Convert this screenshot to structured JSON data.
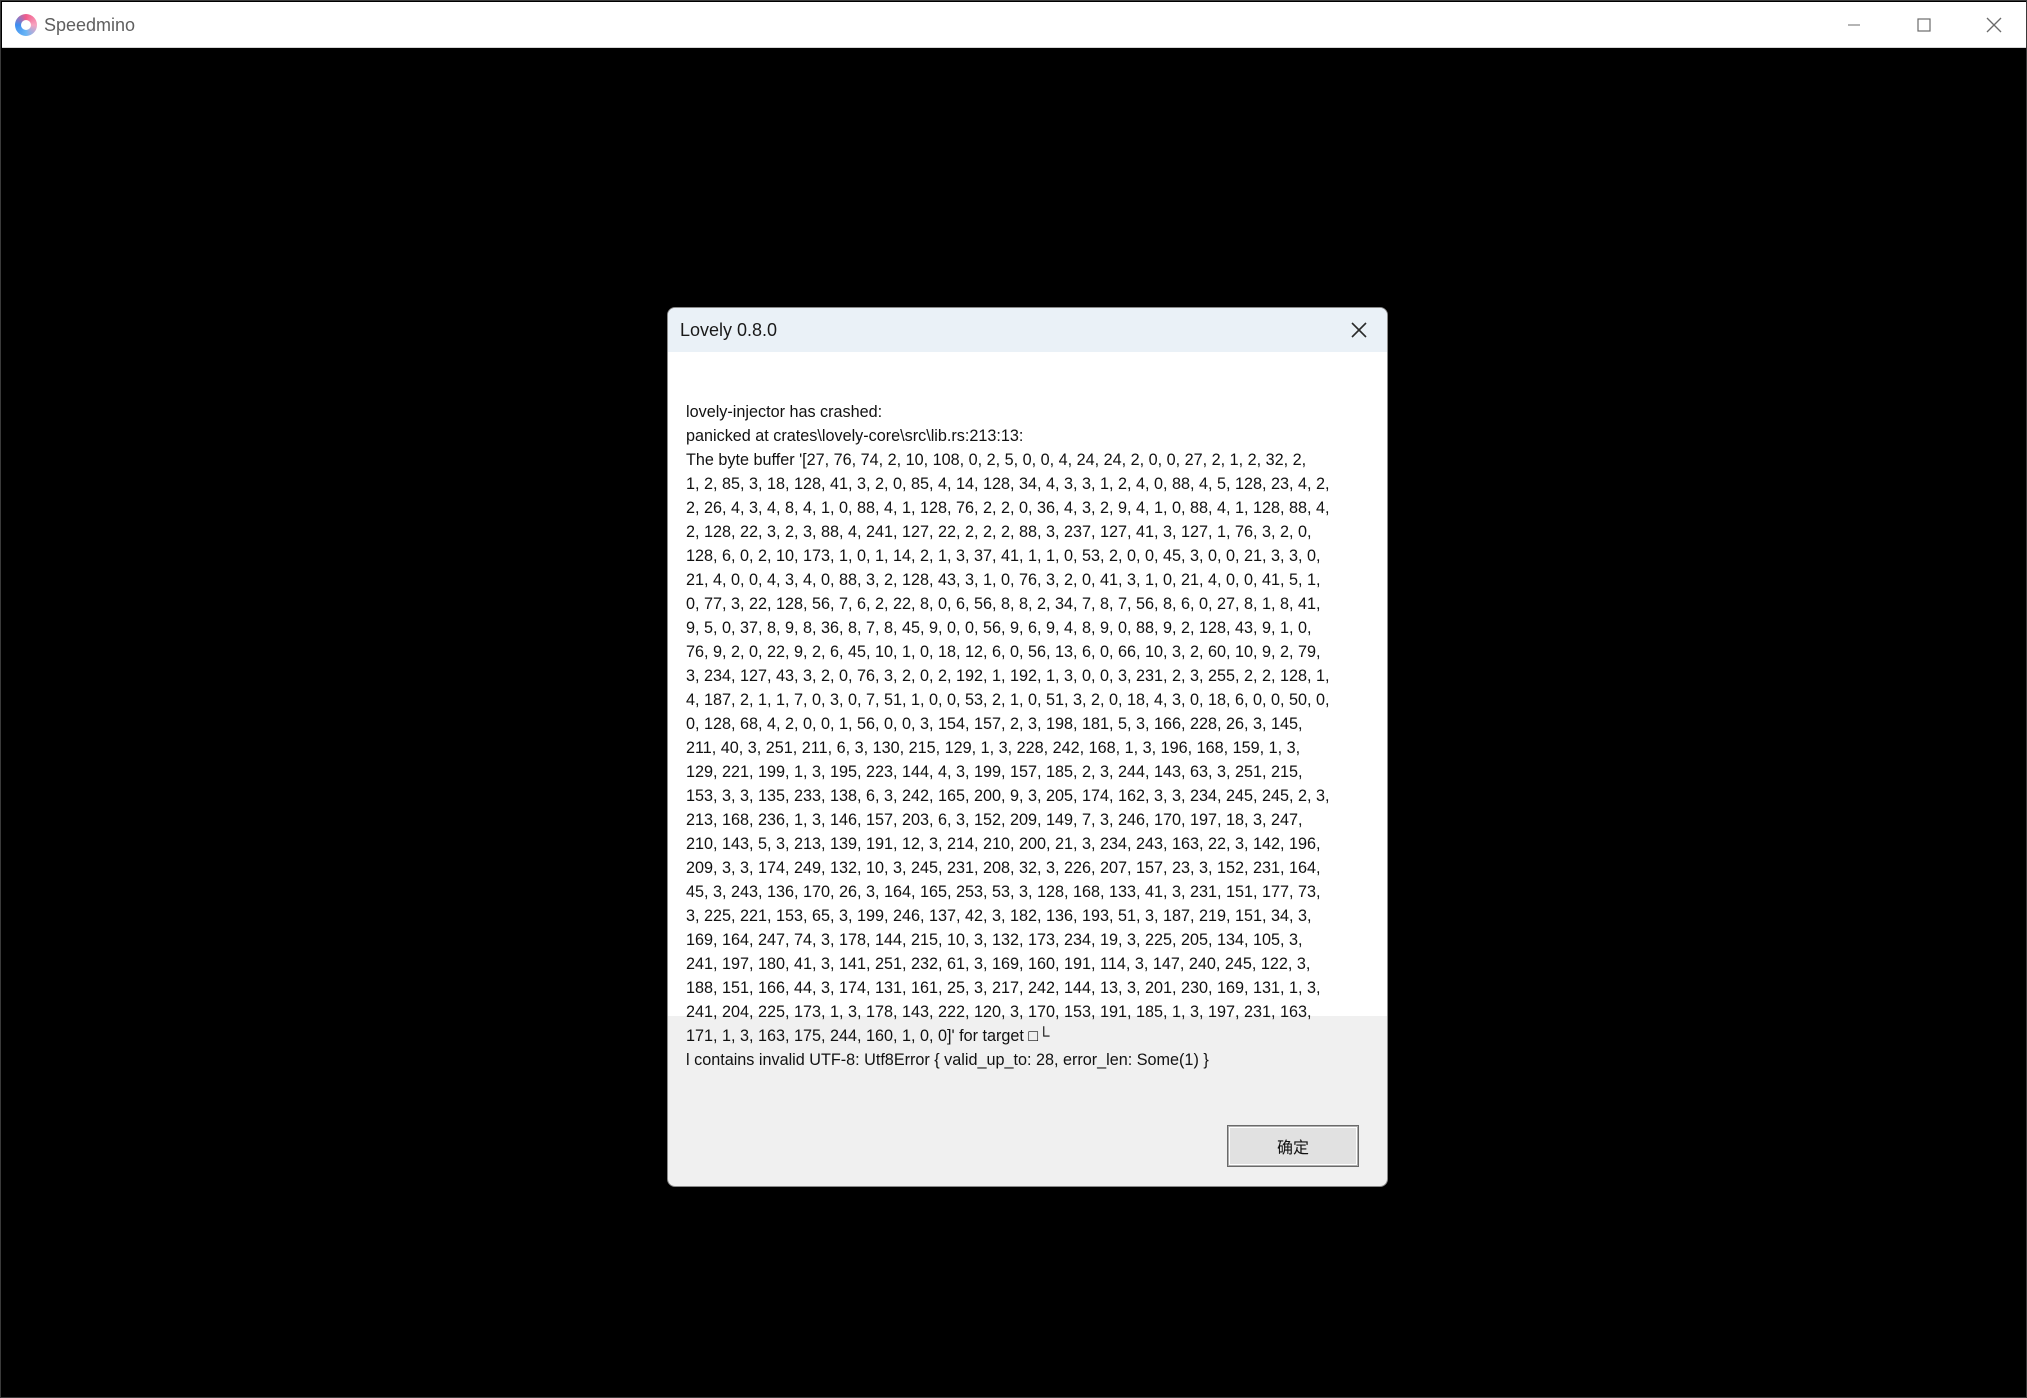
{
  "window": {
    "title": "Speedmino",
    "icon": "speedmino-app-icon",
    "controls": {
      "minimize_icon": "minimize-icon",
      "maximize_icon": "maximize-icon",
      "close_icon": "close-icon"
    }
  },
  "dialog": {
    "title": "Lovely 0.8.0",
    "close_icon": "close-icon",
    "message": "lovely-injector has crashed:\npanicked at crates\\lovely-core\\src\\lib.rs:213:13:\nThe byte buffer '[27, 76, 74, 2, 10, 108, 0, 2, 5, 0, 0, 4, 24, 24, 2, 0, 0, 27, 2, 1, 2, 32, 2,\n1, 2, 85, 3, 18, 128, 41, 3, 2, 0, 85, 4, 14, 128, 34, 4, 3, 3, 1, 2, 4, 0, 88, 4, 5, 128, 23, 4, 2,\n2, 26, 4, 3, 4, 8, 4, 1, 0, 88, 4, 1, 128, 76, 2, 2, 0, 36, 4, 3, 2, 9, 4, 1, 0, 88, 4, 1, 128, 88, 4,\n2, 128, 22, 3, 2, 3, 88, 4, 241, 127, 22, 2, 2, 2, 88, 3, 237, 127, 41, 3, 127, 1, 76, 3, 2, 0,\n128, 6, 0, 2, 10, 173, 1, 0, 1, 14, 2, 1, 3, 37, 41, 1, 1, 0, 53, 2, 0, 0, 45, 3, 0, 0, 21, 3, 3, 0,\n21, 4, 0, 0, 4, 3, 4, 0, 88, 3, 2, 128, 43, 3, 1, 0, 76, 3, 2, 0, 41, 3, 1, 0, 21, 4, 0, 0, 41, 5, 1,\n0, 77, 3, 22, 128, 56, 7, 6, 2, 22, 8, 0, 6, 56, 8, 8, 2, 34, 7, 8, 7, 56, 8, 6, 0, 27, 8, 1, 8, 41,\n9, 5, 0, 37, 8, 9, 8, 36, 8, 7, 8, 45, 9, 0, 0, 56, 9, 6, 9, 4, 8, 9, 0, 88, 9, 2, 128, 43, 9, 1, 0,\n76, 9, 2, 0, 22, 9, 2, 6, 45, 10, 1, 0, 18, 12, 6, 0, 56, 13, 6, 0, 66, 10, 3, 2, 60, 10, 9, 2, 79,\n3, 234, 127, 43, 3, 2, 0, 76, 3, 2, 0, 2, 192, 1, 192, 1, 3, 0, 0, 3, 231, 2, 3, 255, 2, 2, 128, 1,\n4, 187, 2, 1, 1, 7, 0, 3, 0, 7, 51, 1, 0, 0, 53, 2, 1, 0, 51, 3, 2, 0, 18, 4, 3, 0, 18, 6, 0, 0, 50, 0,\n0, 128, 68, 4, 2, 0, 0, 1, 56, 0, 0, 3, 154, 157, 2, 3, 198, 181, 5, 3, 166, 228, 26, 3, 145,\n211, 40, 3, 251, 211, 6, 3, 130, 215, 129, 1, 3, 228, 242, 168, 1, 3, 196, 168, 159, 1, 3,\n129, 221, 199, 1, 3, 195, 223, 144, 4, 3, 199, 157, 185, 2, 3, 244, 143, 63, 3, 251, 215,\n153, 3, 3, 135, 233, 138, 6, 3, 242, 165, 200, 9, 3, 205, 174, 162, 3, 3, 234, 245, 245, 2, 3,\n213, 168, 236, 1, 3, 146, 157, 203, 6, 3, 152, 209, 149, 7, 3, 246, 170, 197, 18, 3, 247,\n210, 143, 5, 3, 213, 139, 191, 12, 3, 214, 210, 200, 21, 3, 234, 243, 163, 22, 3, 142, 196,\n209, 3, 3, 174, 249, 132, 10, 3, 245, 231, 208, 32, 3, 226, 207, 157, 23, 3, 152, 231, 164,\n45, 3, 243, 136, 170, 26, 3, 164, 165, 253, 53, 3, 128, 168, 133, 41, 3, 231, 151, 177, 73,\n3, 225, 221, 153, 65, 3, 199, 246, 137, 42, 3, 182, 136, 193, 51, 3, 187, 219, 151, 34, 3,\n169, 164, 247, 74, 3, 178, 144, 215, 10, 3, 132, 173, 234, 19, 3, 225, 205, 134, 105, 3,\n241, 197, 180, 41, 3, 141, 251, 232, 61, 3, 169, 160, 191, 114, 3, 147, 240, 245, 122, 3,\n188, 151, 166, 44, 3, 174, 131, 161, 25, 3, 217, 242, 144, 13, 3, 201, 230, 169, 131, 1, 3,\n241, 204, 225, 173, 1, 3, 178, 143, 222, 120, 3, 170, 153, 191, 185, 1, 3, 197, 231, 163,\n171, 1, 3, 163, 175, 244, 160, 1, 0, 0]' for target □└\nl contains invalid UTF-8: Utf8Error { valid_up_to: 28, error_len: Some(1) }",
    "ok_label": "确定"
  }
}
